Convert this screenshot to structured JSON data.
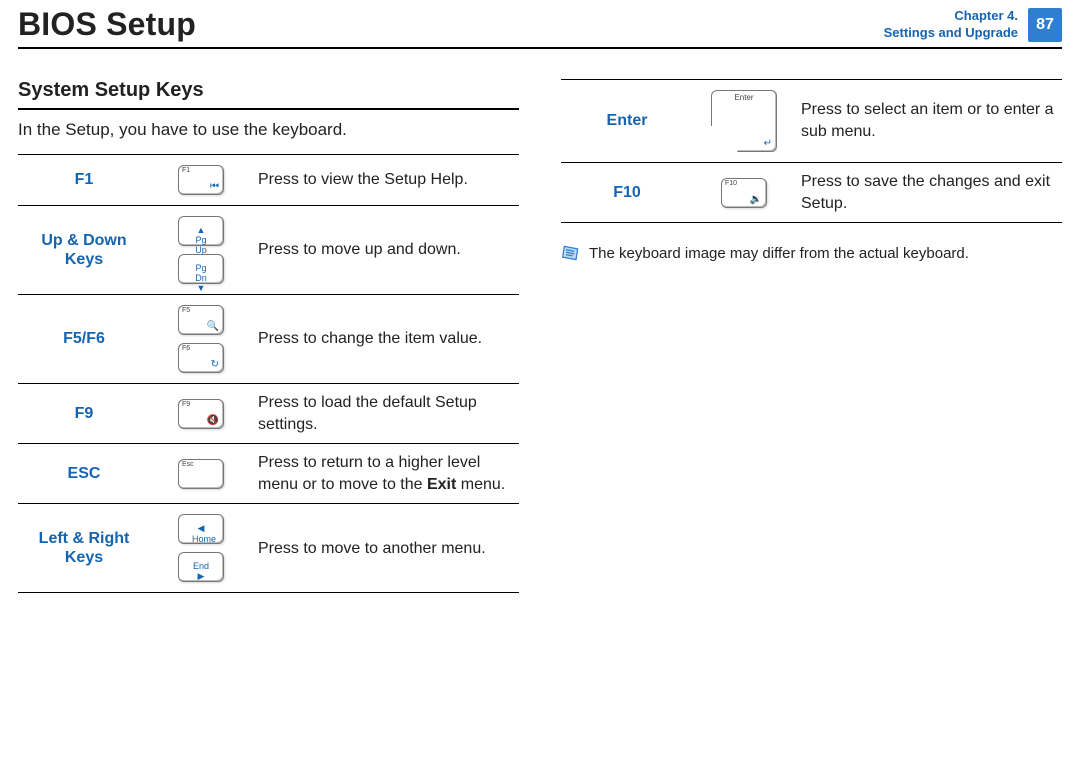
{
  "header": {
    "title": "BIOS Setup",
    "chapter_line1": "Chapter 4.",
    "chapter_line2": "Settings and Upgrade",
    "page_number": "87"
  },
  "section": {
    "title": "System Setup Keys",
    "lead": "In the Setup, you have to use the keyboard."
  },
  "keys_left": [
    {
      "name": "F1",
      "desc": "Press to view the Setup Help.",
      "caps": [
        {
          "label": "F1",
          "glyph": "⏮"
        }
      ]
    },
    {
      "name": "Up & Down Keys",
      "desc": "Press to move up and down.",
      "caps": [
        {
          "label": "",
          "mid": "▲ Pg Up"
        },
        {
          "label": "",
          "mid": "Pg Dn ▼"
        }
      ]
    },
    {
      "name": "F5/F6",
      "desc": "Press to change the item value.",
      "caps": [
        {
          "label": "F5",
          "glyph": "🔍"
        },
        {
          "label": "F6",
          "glyph": "↻"
        }
      ]
    },
    {
      "name": "F9",
      "desc": "Press to load the default Setup settings.",
      "caps": [
        {
          "label": "F9",
          "glyph": "🔇"
        }
      ]
    },
    {
      "name": "ESC",
      "desc_html": "Press to return to a higher level menu or to move to the <b class='inbody'>Exit</b> menu.",
      "caps": [
        {
          "label": "Esc",
          "glyph": ""
        }
      ]
    },
    {
      "name": "Left & Right Keys",
      "desc": "Press to move to another menu.",
      "caps": [
        {
          "label": "",
          "mid": "◀ Home"
        },
        {
          "label": "",
          "mid": "End ▶"
        }
      ]
    }
  ],
  "keys_right": [
    {
      "name": "Enter",
      "desc": "Press to select an item or to enter a sub menu.",
      "caps": [
        {
          "label": "Enter",
          "glyph": "↵",
          "shape": "enter"
        }
      ]
    },
    {
      "name": "F10",
      "desc": "Press to save the changes and exit Setup.",
      "caps": [
        {
          "label": "F10",
          "glyph": "🔉"
        }
      ]
    }
  ],
  "note": "The keyboard image may differ from the actual keyboard."
}
